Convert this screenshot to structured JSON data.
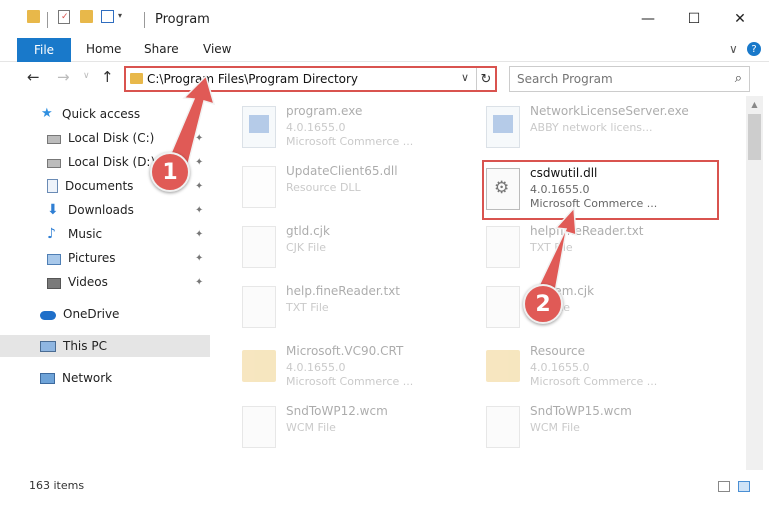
{
  "window": {
    "title": "Program",
    "minimize_glyph": "—",
    "maximize_glyph": "☐",
    "close_glyph": "✕"
  },
  "ribbon": {
    "tabs": [
      "File",
      "Home",
      "Share",
      "View"
    ],
    "expand_glyph": "∨",
    "help_glyph": "?"
  },
  "nav": {
    "back_glyph": "←",
    "forward_glyph": "→",
    "up_glyph": "↑",
    "recent_glyph": "∨",
    "address": "C:\\Program Files\\Program Directory",
    "dropdown_glyph": "∨",
    "refresh_glyph": "↻",
    "search_placeholder": "Search Program",
    "search_glyph": "⌕"
  },
  "sidebar": {
    "items": [
      {
        "label": "Quick access",
        "icon": "star-icon"
      },
      {
        "label": "Local Disk (C:)",
        "icon": "drive-icon"
      },
      {
        "label": "Local Disk (D:)",
        "icon": "drive-icon"
      },
      {
        "label": "Documents",
        "icon": "documents-icon"
      },
      {
        "label": "Downloads",
        "icon": "download-icon"
      },
      {
        "label": "Music",
        "icon": "music-icon"
      },
      {
        "label": "Pictures",
        "icon": "pictures-icon"
      },
      {
        "label": "Videos",
        "icon": "videos-icon"
      },
      {
        "label": "OneDrive",
        "icon": "cloud-icon"
      },
      {
        "label": "This PC",
        "icon": "computer-icon"
      },
      {
        "label": "Network",
        "icon": "network-icon"
      }
    ],
    "pin_glyph": "📌"
  },
  "files": [
    {
      "name": "program.exe",
      "line2": "4.0.1655.0",
      "line3": "Microsoft Commerce ..."
    },
    {
      "name": "NetworkLicenseServer.exe",
      "line2": "ABBY network licens...",
      "line3": ""
    },
    {
      "name": "UpdateClient65.dll",
      "line2": "Resource DLL",
      "line3": ""
    },
    {
      "name": "csdwutil.dll",
      "line2": "4.0.1655.0",
      "line3": "Microsoft Commerce ..."
    },
    {
      "name": "gtld.cjk",
      "line2": "CJK File",
      "line3": ""
    },
    {
      "name": "helpflineReader.txt",
      "line2": "TXT File",
      "line3": ""
    },
    {
      "name": "help.fineReader.txt",
      "line2": "TXT File",
      "line3": ""
    },
    {
      "name": "system.cjk",
      "line2": "CJK File",
      "line3": ""
    },
    {
      "name": "Microsoft.VC90.CRT",
      "line2": "4.0.1655.0",
      "line3": "Microsoft Commerce ..."
    },
    {
      "name": "Resource",
      "line2": "4.0.1655.0",
      "line3": "Microsoft Commerce ..."
    },
    {
      "name": "SndToWP12.wcm",
      "line2": "WCM File",
      "line3": ""
    },
    {
      "name": "SndToWP15.wcm",
      "line2": "WCM File",
      "line3": ""
    }
  ],
  "status": {
    "count": "163 items"
  },
  "annotations": {
    "step1": "1",
    "step2": "2",
    "color": "#e05a56"
  }
}
